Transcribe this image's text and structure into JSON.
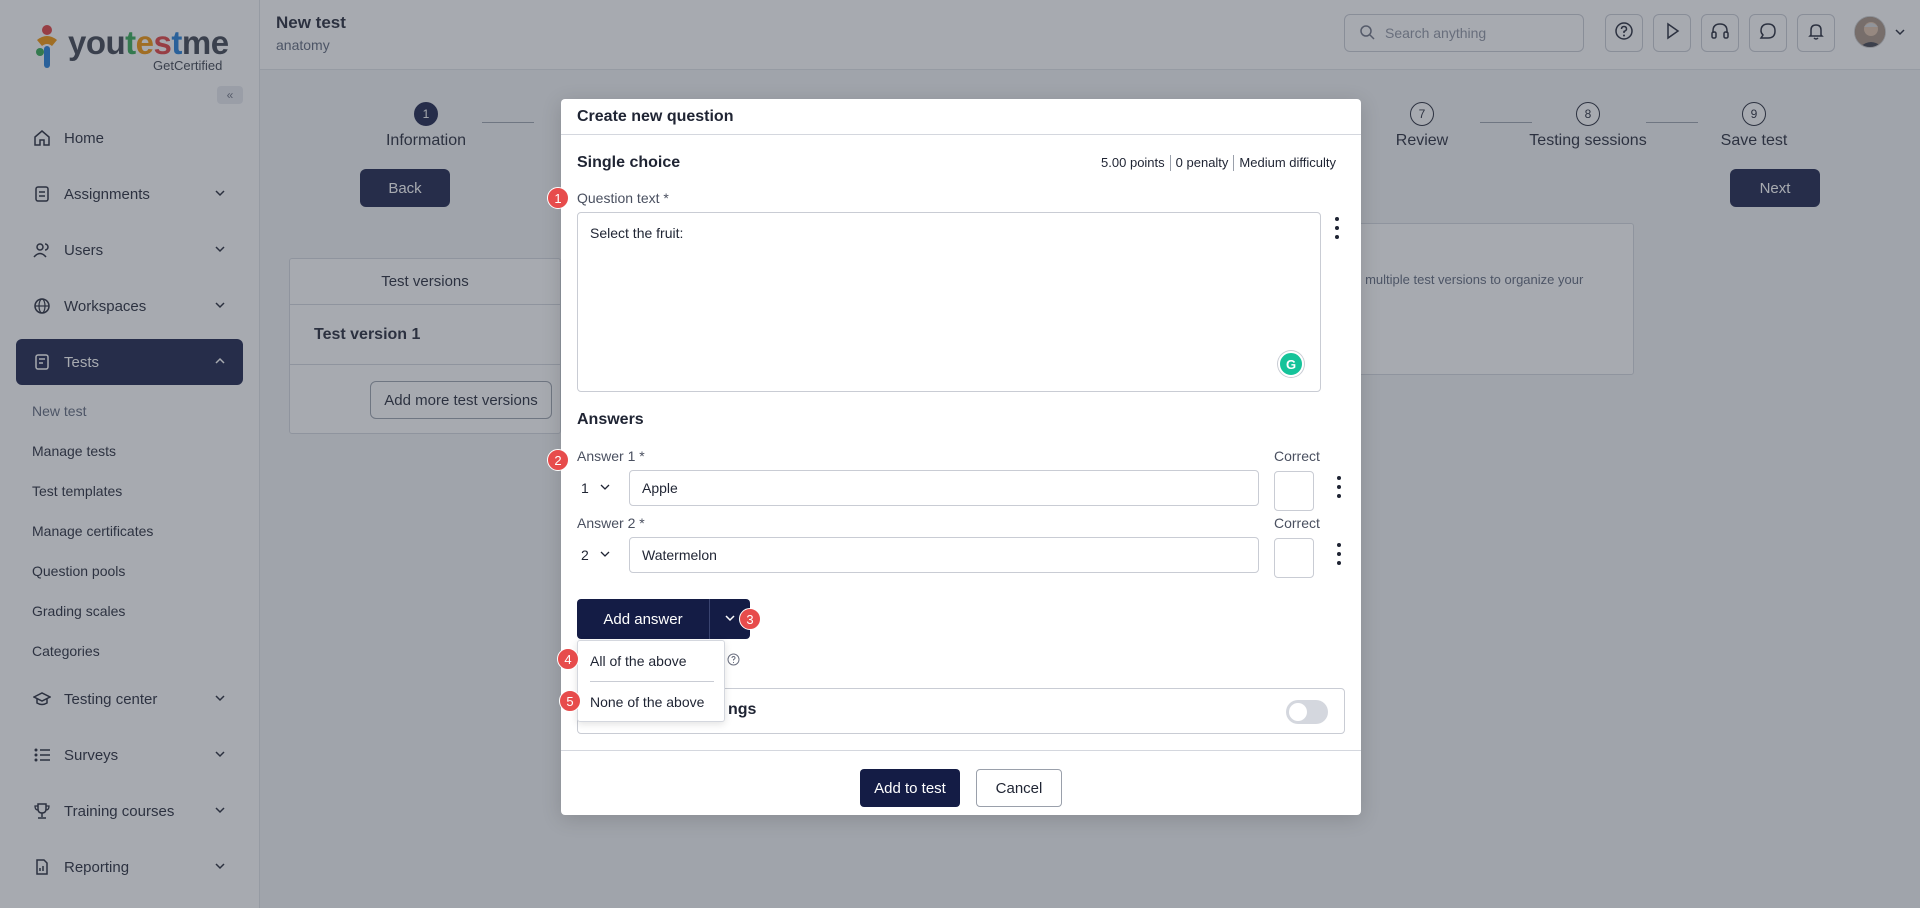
{
  "brand": {
    "name_a": "you",
    "name_b": "t",
    "name_c": "e",
    "name_d": "s",
    "name_e": "t",
    "name_f": "me",
    "sub": "GetCertified",
    "collapse": "«"
  },
  "sidebar": {
    "items": [
      {
        "label": "Home",
        "icon": "home-icon"
      },
      {
        "label": "Assignments",
        "icon": "assignments-icon"
      },
      {
        "label": "Users",
        "icon": "users-icon"
      },
      {
        "label": "Workspaces",
        "icon": "globe-icon"
      },
      {
        "label": "Tests",
        "icon": "tests-icon"
      },
      {
        "label": "Testing center",
        "icon": "graduation-icon"
      },
      {
        "label": "Surveys",
        "icon": "list-icon"
      },
      {
        "label": "Training courses",
        "icon": "trophy-icon"
      },
      {
        "label": "Reporting",
        "icon": "report-icon"
      }
    ],
    "tests_sub": [
      "New test",
      "Manage tests",
      "Test templates",
      "Manage certificates",
      "Question pools",
      "Grading scales",
      "Categories"
    ]
  },
  "header": {
    "title": "New test",
    "subtitle": "anatomy",
    "search_placeholder": "Search anything"
  },
  "steps": [
    {
      "num": "1",
      "label": "Information"
    },
    {
      "num": "7",
      "label": "Review"
    },
    {
      "num": "8",
      "label": "Testing sessions"
    },
    {
      "num": "9",
      "label": "Save test"
    }
  ],
  "nav": {
    "back": "Back",
    "next": "Next"
  },
  "versions": {
    "header": "Test versions",
    "row": "Test version 1",
    "add": "Add more test versions"
  },
  "info_text": "ge multiple test versions to organize your",
  "modal": {
    "title": "Create new question",
    "type": "Single choice",
    "points": "5.00 points",
    "penalty": "0 penalty",
    "difficulty": "Medium difficulty",
    "question_label": "Question text *",
    "question_text": "Select the fruit:",
    "grammarly": "G",
    "answers_title": "Answers",
    "answers": [
      {
        "label": "Answer 1 *",
        "order": "1",
        "value": "Apple",
        "correct_label": "Correct"
      },
      {
        "label": "Answer 2 *",
        "order": "2",
        "value": "Watermelon",
        "correct_label": "Correct"
      }
    ],
    "add_answer": "Add answer",
    "settings_label": "ngs",
    "add_to_test": "Add to test",
    "cancel": "Cancel"
  },
  "dropdown": {
    "items": [
      "All of the above",
      "None of the above"
    ]
  },
  "badges": [
    "1",
    "2",
    "3",
    "4",
    "5"
  ]
}
